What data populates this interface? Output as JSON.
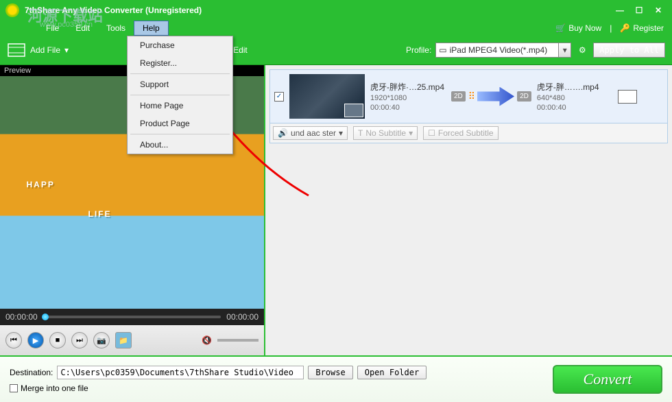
{
  "window": {
    "title": "7thShare Any Video Converter (Unregistered)"
  },
  "watermark": {
    "main": "河源下载站",
    "sub": "www.pc0359.cn"
  },
  "menu": {
    "file": "File",
    "edit": "Edit",
    "tools": "Tools",
    "help": "Help"
  },
  "header": {
    "buy_now": "Buy Now",
    "register": "Register"
  },
  "toolbar": {
    "add_file": "Add File",
    "edit": "Edit",
    "profile_label": "Profile:",
    "profile_value": "iPad MPEG4 Video(*.mp4)",
    "apply_all": "Apply to All"
  },
  "help_menu": {
    "purchase": "Purchase",
    "register": "Register...",
    "support": "Support",
    "home_page": "Home Page",
    "product_page": "Product Page",
    "about": "About..."
  },
  "preview": {
    "label": "Preview",
    "overlay1": "HAPP",
    "overlay2": "LIFE",
    "time_start": "00:00:00",
    "time_end": "00:00:00"
  },
  "item": {
    "src_name": "虎牙-胖炸·…25.mp4",
    "src_res": "1920*1080",
    "src_dur": "00:00:40",
    "dst_name": "虎牙-胖…….mp4",
    "dst_res": "640*480",
    "dst_dur": "00:00:40",
    "badge": "2D",
    "audio": "und aac ster",
    "no_sub": "No Subtitle",
    "forced_sub": "Forced Subtitle"
  },
  "bottom": {
    "dest_label": "Destination:",
    "dest_path": "C:\\Users\\pc0359\\Documents\\7thShare Studio\\Video",
    "browse": "Browse",
    "open_folder": "Open Folder",
    "merge": "Merge into one file",
    "convert": "Convert"
  }
}
